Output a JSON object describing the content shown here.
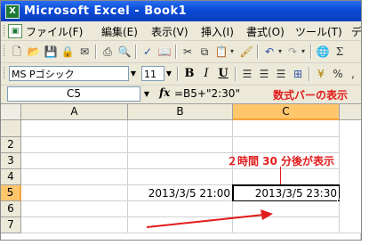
{
  "window": {
    "title": "Microsoft Excel - Book1",
    "icon": "excel-icon"
  },
  "menu": {
    "items": [
      "ファイル(F)",
      "編集(E)",
      "表示(V)",
      "挿入(I)",
      "書式(O)",
      "ツール(T)",
      "デ"
    ]
  },
  "toolbar": {
    "font_name": "MS Pゴシック",
    "font_size": "11",
    "bold": "B",
    "italic": "I",
    "underline": "U"
  },
  "formula_bar": {
    "name_box": "C5",
    "fx": "fx",
    "formula": "=B5+\"2:30\"",
    "note": "数式バーの表示"
  },
  "sheet": {
    "columns": [
      "A",
      "B",
      "C"
    ],
    "rows": [
      "2",
      "3",
      "4",
      "5",
      "6",
      "7"
    ],
    "active_cell": "C5",
    "cells": {
      "B5": "2013/3/5 21:00",
      "C5": "2013/3/5 23:30"
    }
  },
  "annotation": {
    "callout": "２時間 30 分後が表示",
    "color": "#e21b1b"
  }
}
